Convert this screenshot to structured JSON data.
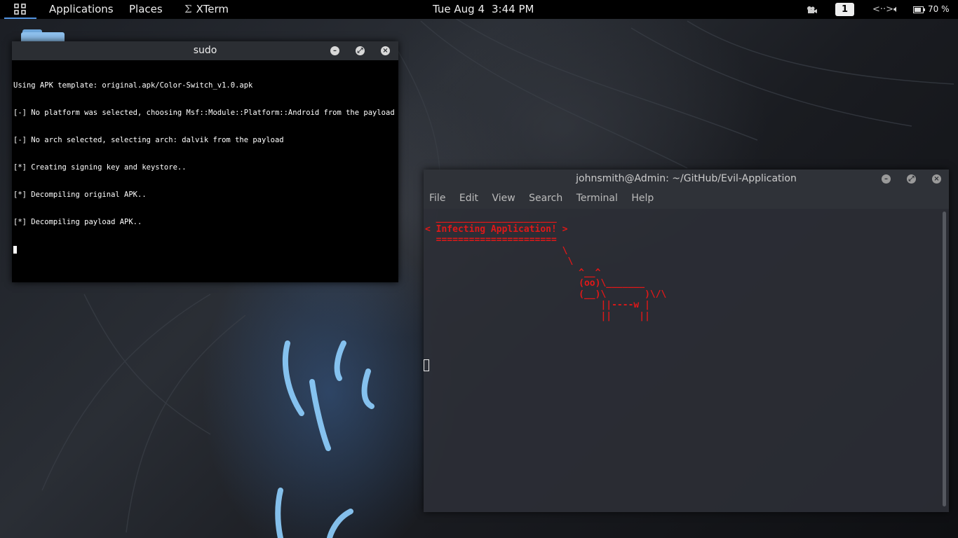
{
  "topbar": {
    "applications": "Applications",
    "places": "Places",
    "active_app": "XTerm",
    "active_app_icon": "xterm-icon",
    "date": "Tue Aug 4",
    "time": "3:44 PM",
    "workspace": "1",
    "battery": "70 %",
    "battery_level": 0.7
  },
  "sudo_window": {
    "title": "sudo",
    "lines": [
      "Using APK template: original.apk/Color-Switch_v1.0.apk",
      "[-] No platform was selected, choosing Msf::Module::Platform::Android from the payload",
      "[-] No arch selected, selecting arch: dalvik from the payload",
      "[*] Creating signing key and keystore..",
      "[*] Decompiling original APK..",
      "[*] Decompiling payload APK.."
    ]
  },
  "terminal_window": {
    "title": "johnsmith@Admin: ~/GitHub/Evil-Application",
    "menu": [
      "File",
      "Edit",
      "View",
      "Search",
      "Terminal",
      "Help"
    ],
    "cowsay": "  ______________________\n< Infecting Application! >\n  ======================\n                         \\\n                          \\\n                            ^__^\n                            (oo)\\_______\n                            (__)\\       )\\/\\\n                                ||----w |\n                                ||     ||",
    "text_color": "#e01818"
  }
}
